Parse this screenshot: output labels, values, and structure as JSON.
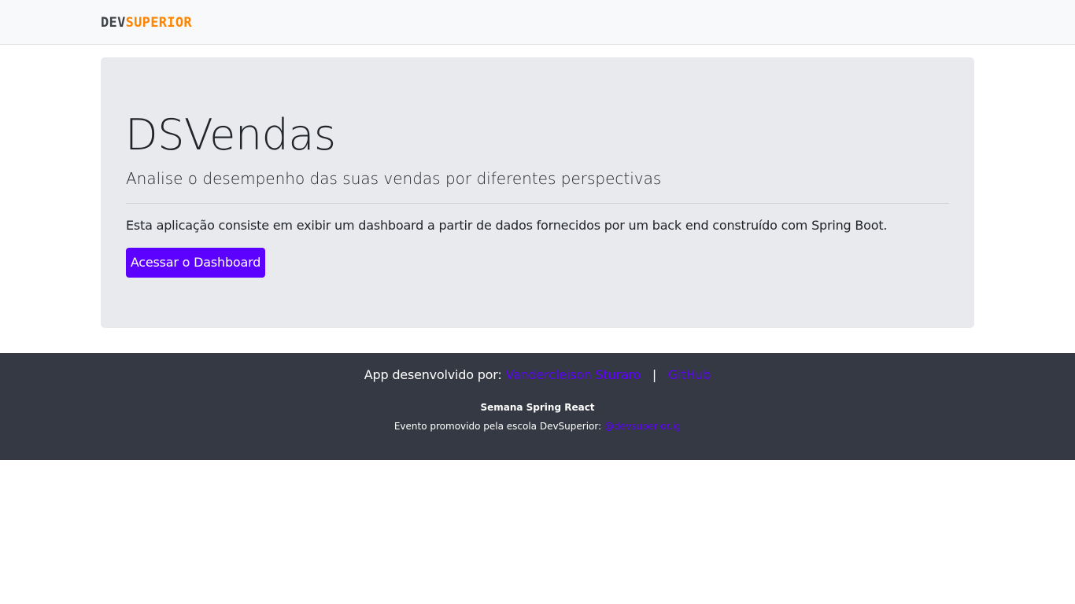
{
  "navbar": {
    "logo_dev": "DEV",
    "logo_superior": "SUPERIOR"
  },
  "jumbotron": {
    "title": "DSVendas",
    "lead": "Analise o desempenho das suas vendas por diferentes perspectivas",
    "description": "Esta aplicação consiste em exibir um dashboard a partir de dados fornecidos por um back end construído com Spring Boot.",
    "button_label": "Acessar o Dashboard"
  },
  "footer": {
    "developed_by": "App desenvolvido por:",
    "developer_name": "Vandercleison Sturaro",
    "separator": "|",
    "github_label": "GitHub",
    "event_name": "Semana Spring React",
    "event_text": "Evento promovido pela escola DevSuperior:",
    "instagram_label": "@devsuperior.ig"
  },
  "colors": {
    "accent": "#5c00ff",
    "logo_orange": "#ff8400",
    "footer_bg": "#353943",
    "jumbotron_bg": "#e9eaee"
  }
}
